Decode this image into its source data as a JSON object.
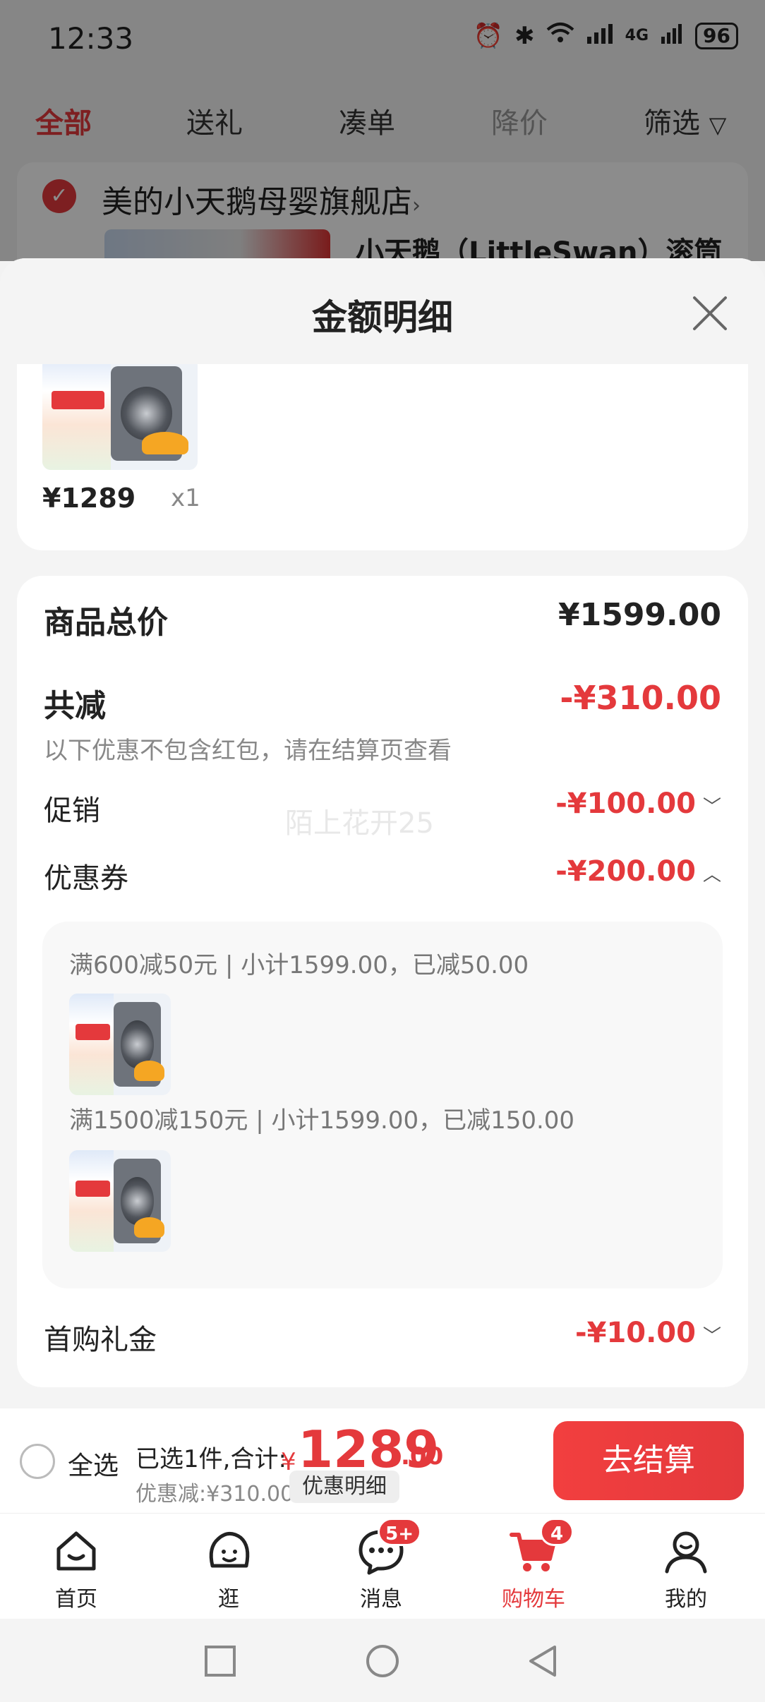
{
  "status_bar": {
    "time": "12:33",
    "battery": "96",
    "network": "4G"
  },
  "filter_tabs": [
    "全部",
    "送礼",
    "凑单",
    "降价",
    "筛选"
  ],
  "store": {
    "name": "美的小天鹅母婴旗舰店",
    "chevron": "›",
    "product_title": "小天鹅（LittleSwan）滚筒"
  },
  "sheet": {
    "title": "金额明细",
    "item": {
      "price": "¥1289",
      "qty": "x1"
    },
    "rows": {
      "goods_total": {
        "label": "商品总价",
        "value": "¥1599.00"
      },
      "total_discount": {
        "label": "共减",
        "value": "-¥310.00",
        "note": "以下优惠不包含红包，请在结算页查看"
      },
      "promotion": {
        "label": "促销",
        "value": "-¥100.00"
      },
      "coupon": {
        "label": "优惠券",
        "value": "-¥200.00"
      },
      "first_purchase": {
        "label": "首购礼金",
        "value": "-¥10.00"
      }
    },
    "coupon_lines": [
      "满600减50元 | 小计1599.00，已减50.00",
      "满1500减150元 | 小计1599.00，已减150.00"
    ],
    "watermark": "陌上花开25"
  },
  "checkout": {
    "select_all": "全选",
    "summary": "已选1件,合计:",
    "yen": "¥",
    "total_int": "1289",
    "total_dec": ".00",
    "discount": "优惠减:¥310.00",
    "detail_link": "优惠明细",
    "button": "去结算"
  },
  "tab_bar": [
    {
      "label": "首页"
    },
    {
      "label": "逛"
    },
    {
      "label": "消息",
      "badge": "5+"
    },
    {
      "label": "购物车",
      "badge": "4"
    },
    {
      "label": "我的"
    }
  ],
  "colors": {
    "accent": "#e4393c",
    "text": "#222222",
    "muted": "#888888"
  }
}
